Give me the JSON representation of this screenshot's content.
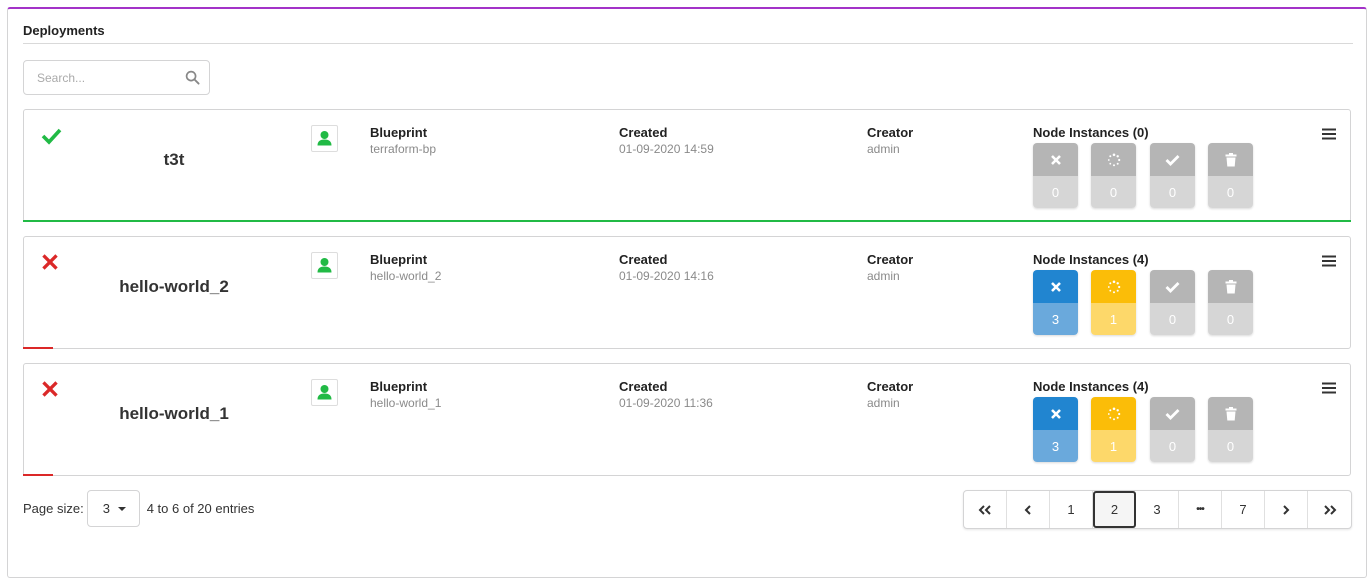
{
  "widget": {
    "title": "Deployments"
  },
  "search": {
    "placeholder": "Search..."
  },
  "field_labels": {
    "blueprint": "Blueprint",
    "created": "Created",
    "creator": "Creator"
  },
  "deployments": [
    {
      "name": "t3t",
      "status": "success",
      "blueprint": "terraform-bp",
      "created": "01-09-2020 14:59",
      "creator": "admin",
      "node_instances_label": "Node Instances (0)",
      "counts": {
        "failed": "0",
        "in_progress": "0",
        "started": "0",
        "deleted": "0"
      }
    },
    {
      "name": "hello-world_2",
      "status": "failed",
      "blueprint": "hello-world_2",
      "created": "01-09-2020 14:16",
      "creator": "admin",
      "node_instances_label": "Node Instances (4)",
      "counts": {
        "failed": "3",
        "in_progress": "1",
        "started": "0",
        "deleted": "0"
      }
    },
    {
      "name": "hello-world_1",
      "status": "failed",
      "blueprint": "hello-world_1",
      "created": "01-09-2020 11:36",
      "creator": "admin",
      "node_instances_label": "Node Instances (4)",
      "counts": {
        "failed": "3",
        "in_progress": "1",
        "started": "0",
        "deleted": "0"
      }
    }
  ],
  "colors": {
    "accent": "#a333c8",
    "success": "#21ba45",
    "error": "#db2828",
    "failed_top": "#2185d0",
    "failed_bot": "#6aa9dc",
    "progress_top": "#fbbd08",
    "progress_bot": "#fdd86a",
    "inactive_top": "#b5b5b5",
    "inactive_bot": "#d6d6d6"
  },
  "pagination": {
    "page_size_label": "Page size:",
    "page_size": "3",
    "entries_text": "4 to 6 of 20 entries",
    "pages": [
      "1",
      "2",
      "3",
      "7"
    ],
    "active_page": "2",
    "ellipsis": "•••"
  }
}
